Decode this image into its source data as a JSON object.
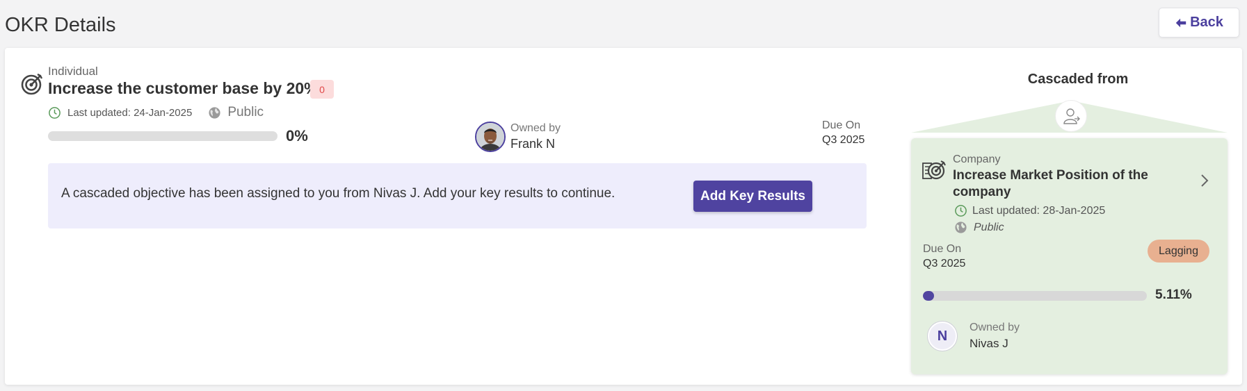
{
  "page": {
    "title": "OKR Details",
    "back_label": "Back"
  },
  "objective": {
    "type": "Individual",
    "title": "Increase the customer base by 20%.",
    "count": "0",
    "last_updated": "Last updated: 24-Jan-2025",
    "visibility": "Public",
    "progress_text": "0%",
    "progress_value": 0,
    "owner_label": "Owned by",
    "owner_name": "Frank N",
    "due_label": "Due On",
    "due_value": "Q3 2025"
  },
  "alert": {
    "message": "A cascaded objective has been assigned to you from Nivas J. Add your key results to continue.",
    "button_label": "Add Key Results"
  },
  "cascade": {
    "heading": "Cascaded from",
    "type": "Company",
    "title": "Increase Market Position of the company",
    "last_updated": "Last updated: 28-Jan-2025",
    "visibility": "Public",
    "due_label": "Due On",
    "due_value": "Q3 2025",
    "status": "Lagging",
    "progress_text": "5.11%",
    "progress_value": 5.11,
    "owner_initial": "N",
    "owner_label": "Owned by",
    "owner_name": "Nivas J"
  },
  "icons": {
    "back": "arrow-left-icon",
    "objective": "target-icon",
    "clock": "clock-icon",
    "globe": "globe-icon",
    "parent": "user-cascade-icon",
    "company": "company-target-icon",
    "chevron": "chevron-right-icon"
  },
  "colors": {
    "accent": "#4f43a0",
    "alert_bg": "#eeedfc",
    "cascade_card_bg": "#e4efe0",
    "lagging_bg": "#e8b090",
    "count_badge_bg": "#fcdcdc",
    "count_badge_text": "#e04848",
    "clock_green": "#5a9a5a"
  }
}
